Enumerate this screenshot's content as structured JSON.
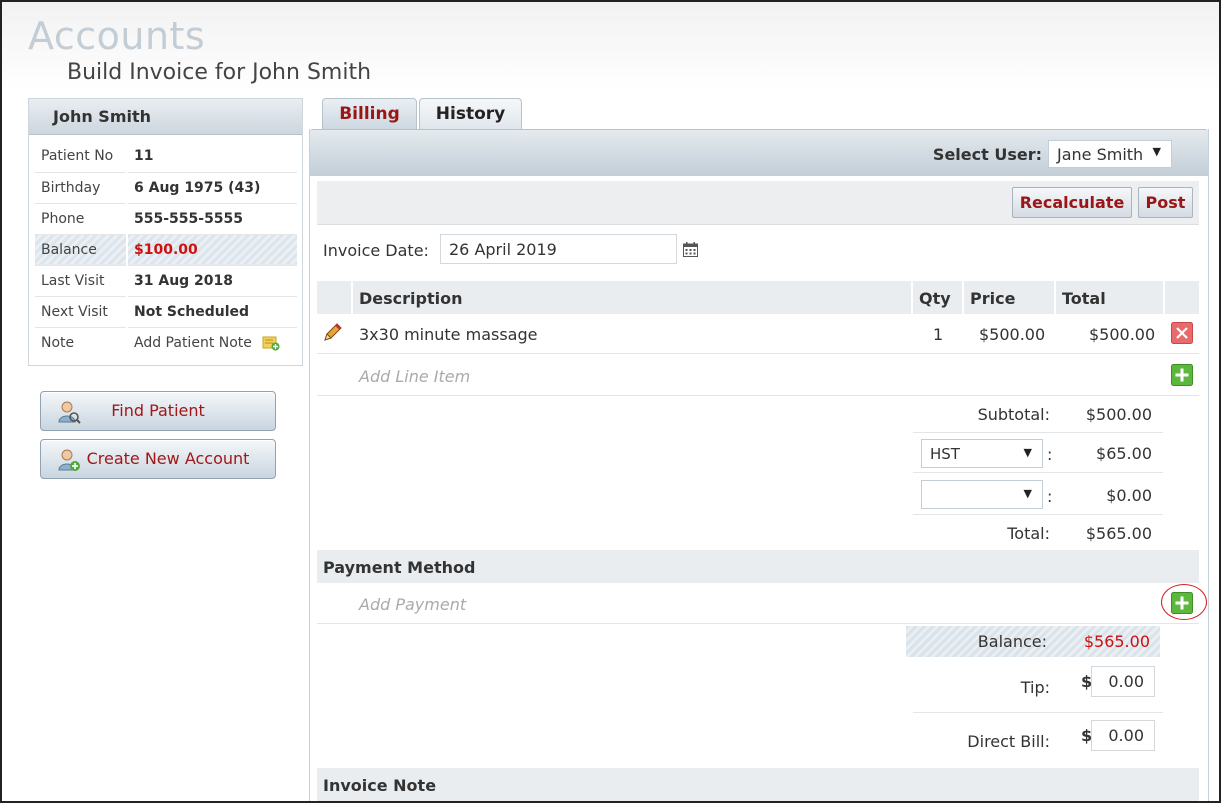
{
  "header": {
    "app_title": "Accounts",
    "subtitle": "Build Invoice for John Smith"
  },
  "patient": {
    "name": "John Smith",
    "fields": [
      {
        "label": "Patient No",
        "value": "11"
      },
      {
        "label": "Birthday",
        "value": "6 Aug 1975 (43)"
      },
      {
        "label": "Phone",
        "value": "555-555-5555"
      },
      {
        "label": "Balance",
        "value": "$100.00"
      },
      {
        "label": "Last Visit",
        "value": "31 Aug 2018"
      },
      {
        "label": "Next Visit",
        "value": "Not Scheduled"
      },
      {
        "label": "Note",
        "value": "Add Patient Note"
      }
    ]
  },
  "sidebar_buttons": {
    "find_patient": "Find Patient",
    "create_account": "Create New Account"
  },
  "tabs": [
    {
      "label": "Billing",
      "active": true
    },
    {
      "label": "History",
      "active": false
    }
  ],
  "select_user": {
    "label": "Select User:",
    "value": "Jane Smith"
  },
  "toolbar": {
    "recalculate": "Recalculate",
    "post": "Post"
  },
  "invoice_date": {
    "label": "Invoice Date:",
    "value": "26 April 2019"
  },
  "line_items": {
    "columns": [
      "Description",
      "Qty",
      "Price",
      "Total"
    ],
    "rows": [
      {
        "description": "3x30 minute massage",
        "qty": "1",
        "price": "$500.00",
        "total": "$500.00"
      }
    ],
    "add_placeholder": "Add Line Item"
  },
  "summary": {
    "subtotal_label": "Subtotal:",
    "subtotal": "$500.00",
    "tax1_select": "HST",
    "tax1_amount": "$65.00",
    "tax2_select": "",
    "tax2_amount": "$0.00",
    "total_label": "Total:",
    "total": "$565.00",
    "colon": ":"
  },
  "payment": {
    "heading": "Payment Method",
    "add_placeholder": "Add Payment",
    "balance_label": "Balance:",
    "balance": "$565.00",
    "tip_label": "Tip:",
    "tip_currency": "$",
    "tip_value": "0.00",
    "direct_bill_label": "Direct Bill:",
    "direct_bill_currency": "$",
    "direct_bill_value": "0.00"
  },
  "invoice_note": {
    "heading": "Invoice Note"
  },
  "colors": {
    "accent_red": "#9a1616",
    "balance_red": "#cc1111",
    "add_green": "#4aa82e",
    "delete_red": "#e05a5a",
    "highlight_ring": "#d81e1e"
  },
  "icons": [
    "note-add-icon",
    "find-patient-icon",
    "create-account-icon",
    "calendar-icon",
    "pencil-icon",
    "delete-icon",
    "add-line-icon",
    "add-payment-icon",
    "dropdown-caret-icon"
  ]
}
